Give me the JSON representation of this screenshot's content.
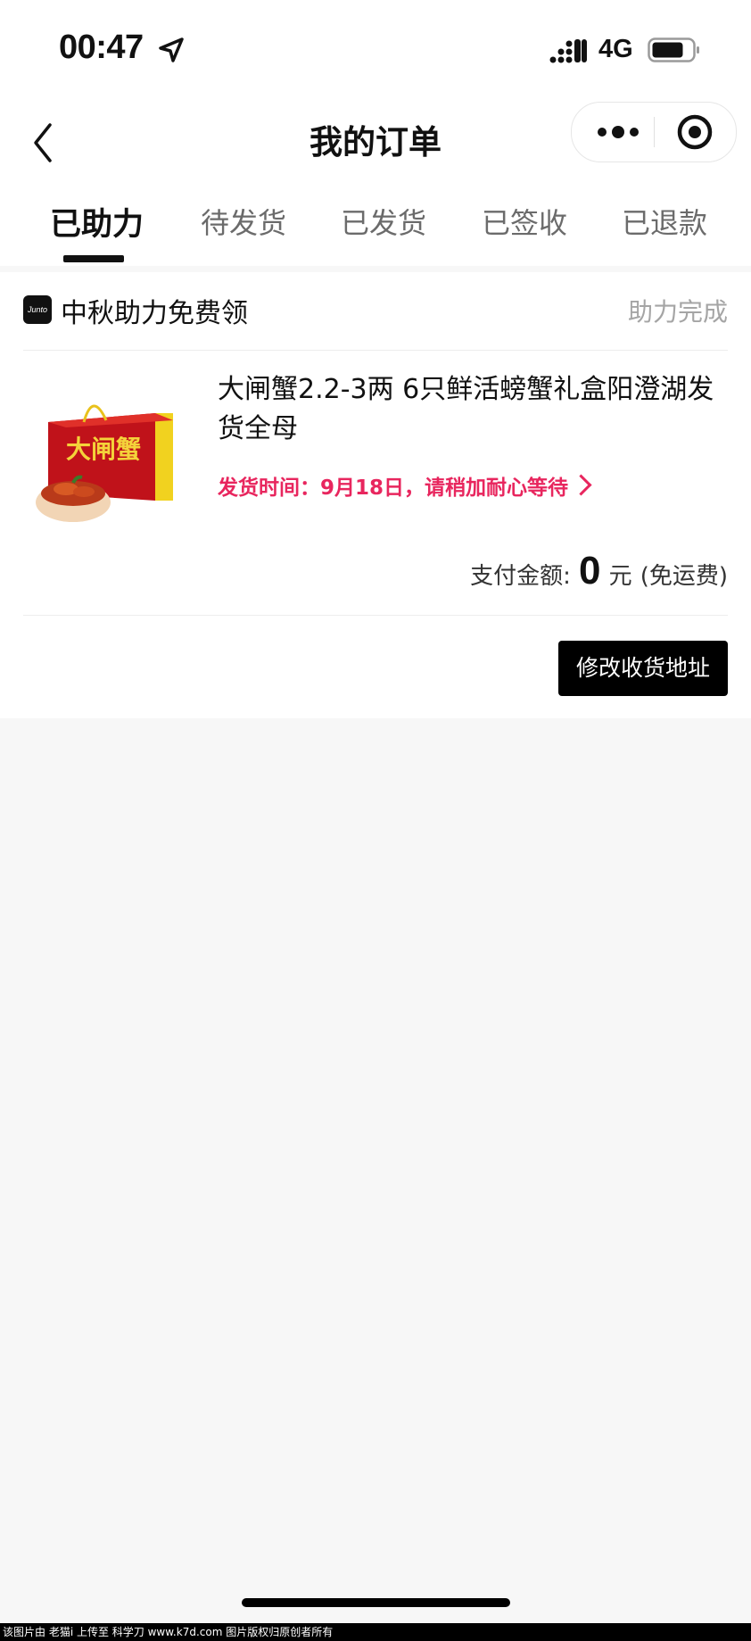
{
  "status_bar": {
    "time": "00:47",
    "network": "4G",
    "icons": [
      "location-arrow-icon",
      "signal-icon",
      "battery-icon"
    ]
  },
  "nav": {
    "title": "我的订单",
    "icons": [
      "back-icon",
      "more-icon",
      "close-icon"
    ]
  },
  "tabs": [
    {
      "label": "已助力",
      "active": true
    },
    {
      "label": "待发货",
      "active": false
    },
    {
      "label": "已发货",
      "active": false
    },
    {
      "label": "已签收",
      "active": false
    },
    {
      "label": "已退款",
      "active": false
    }
  ],
  "order": {
    "shop_logo_text": "Junto",
    "shop_name": "中秋助力免费领",
    "status": "助力完成",
    "product_title": "大闸蟹2.2-3两 6只鲜活螃蟹礼盒阳澄湖发货全母",
    "product_image_text": "大闸蟹",
    "ship_note": "发货时间：9月18日，请稍加耐心等待",
    "pay_label": "支付金额:",
    "pay_amount": "0",
    "pay_unit": "元",
    "pay_note": "(免运费)",
    "modify_button": "修改收货地址"
  },
  "colors": {
    "accent": "#e8265e",
    "button_bg": "#000000",
    "page_bg": "#f7f7f7",
    "muted": "#a5a5a5"
  },
  "watermark": "该图片由 老猫i 上传至 科学刀 www.k7d.com 图片版权归原创者所有"
}
